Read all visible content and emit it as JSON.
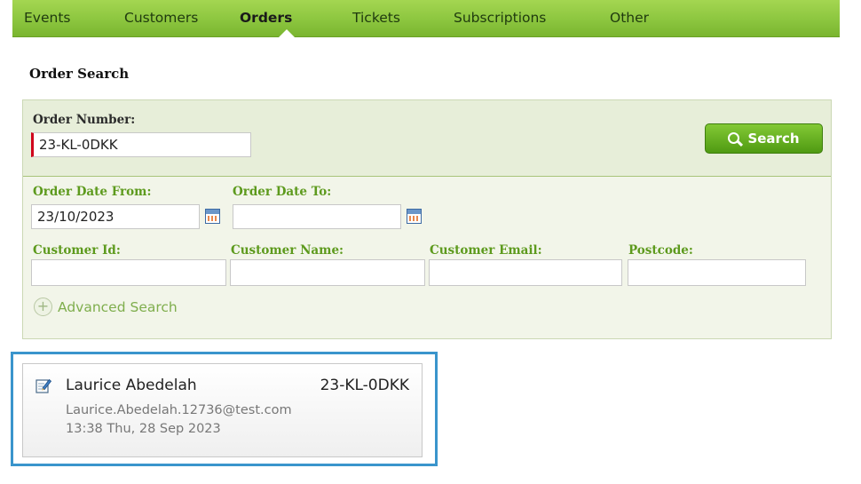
{
  "nav": {
    "items": [
      {
        "label": "Events"
      },
      {
        "label": "Customers"
      },
      {
        "label": "Orders",
        "active": true
      },
      {
        "label": "Tickets"
      },
      {
        "label": "Subscriptions"
      },
      {
        "label": "Other"
      }
    ]
  },
  "page_title": "Order Search",
  "search": {
    "order_number_label": "Order Number:",
    "order_number_value": "23-KL-0DKK",
    "button_label": "Search",
    "date_from_label": "Order Date From:",
    "date_from_value": "23/10/2023",
    "date_to_label": "Order Date To:",
    "date_to_value": "",
    "customer_id_label": "Customer Id:",
    "customer_id_value": "",
    "customer_name_label": "Customer Name:",
    "customer_name_value": "",
    "customer_email_label": "Customer Email:",
    "customer_email_value": "",
    "postcode_label": "Postcode:",
    "postcode_value": "",
    "advanced_label": "Advanced Search"
  },
  "result": {
    "customer_name": "Laurice Abedelah",
    "order_number": "23-KL-0DKK",
    "email": "Laurice.Abedelah.12736@test.com",
    "timestamp": "13:38 Thu, 28 Sep 2023"
  },
  "colors": {
    "nav_green": "#8cc63f",
    "label_green": "#5d9a1d",
    "button_green": "#4f9a12",
    "highlight_blue": "#3a95cc"
  },
  "icons": {
    "search": "magnifier-icon",
    "calendar": "calendar-icon",
    "advanced": "plus-circle-icon",
    "result": "edit-note-icon"
  }
}
